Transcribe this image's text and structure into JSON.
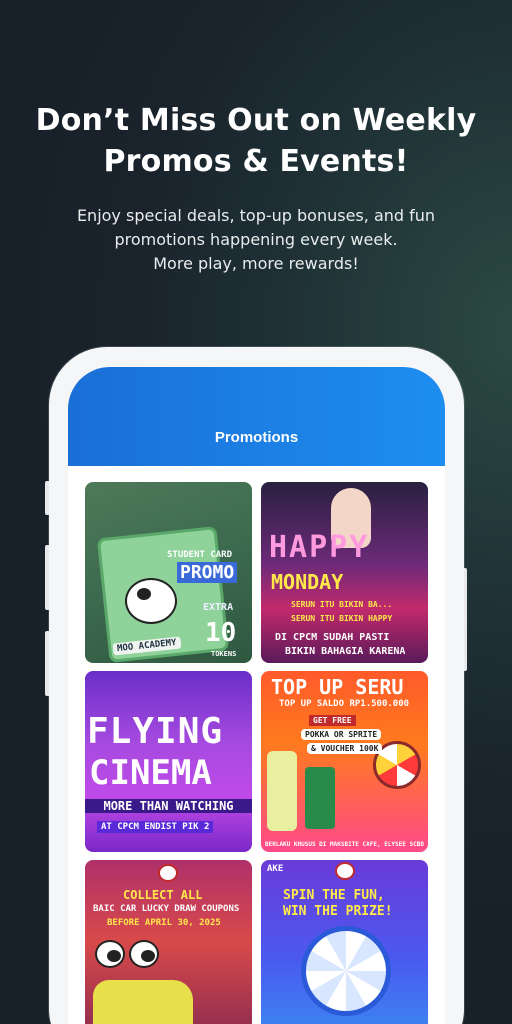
{
  "headline": {
    "line1": "Don’t Miss Out on Weekly",
    "line2": "Promos & Events!"
  },
  "subtext": {
    "line1": "Enjoy special deals, top-up bonuses, and fun",
    "line2": "promotions happening every week.",
    "line3": "More play, more rewards!"
  },
  "app": {
    "title": "Promotions",
    "accent": "#1d8ef0"
  },
  "promos": [
    {
      "name": "student-card-promo",
      "texts": [
        "STUDENT CARD",
        "PROMO",
        "EXTRA",
        "10",
        "TOKENS",
        "MOO ACADEMY"
      ]
    },
    {
      "name": "happy-monday",
      "texts": [
        "HAPPY",
        "MONDAY",
        "SERUN ITU BIKIN BA...",
        "SERUN ITU BIKIN HAPPY",
        "DI CPCM SUDAH PASTI",
        "BIKIN BAHAGIA KARENA"
      ]
    },
    {
      "name": "flying-cinema",
      "texts": [
        "FLYING",
        "CINEMA",
        "MORE THAN WATCHING",
        "AT CPCM ENDIST PIK 2"
      ]
    },
    {
      "name": "top-up-seru",
      "texts": [
        "TOP UP SERU",
        "TOP UP SALDO RP1.500.000",
        "GET FREE",
        "POKKA OR SPRITE",
        "& VOUCHER 100K",
        "BERLAKU KHUSUS DI MAKSBITE CAFE, ELYSEE SCBD"
      ]
    },
    {
      "name": "collect-all-coupons",
      "texts": [
        "COLLECT ALL",
        "BAIC CAR LUCKY DRAW COUPONS",
        "BEFORE APRIL 30, 2025"
      ]
    },
    {
      "name": "spin-the-fun",
      "texts": [
        "AKE",
        "SPIN THE FUN,",
        "WIN THE PRIZE!"
      ]
    }
  ]
}
